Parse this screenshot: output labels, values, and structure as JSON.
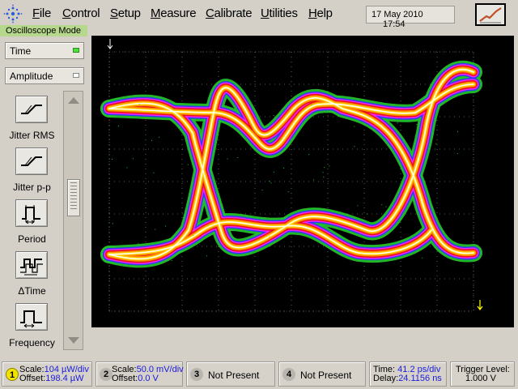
{
  "menu": {
    "file_u": "F",
    "file_rest": "ile",
    "control_u": "C",
    "control_rest": "ontrol",
    "setup_u": "S",
    "setup_rest": "etup",
    "measure_u": "M",
    "measure_rest": "easure",
    "calibrate_u": "C",
    "calibrate_rest": "alibrate",
    "utilities_u": "U",
    "utilities_rest": "tilities",
    "help_u": "H",
    "help_rest": "elp"
  },
  "datetime": {
    "date": "17 May 2010",
    "time": "17:54"
  },
  "mode_tab": "Oscilloscope Mode",
  "left_panel": {
    "time_dropdown": "Time",
    "amplitude_dropdown": "Amplitude",
    "measurements": [
      {
        "label": "Jitter RMS",
        "icon": "jitter-rms-icon"
      },
      {
        "label": "Jitter p-p",
        "icon": "jitter-pp-icon"
      },
      {
        "label": "Period",
        "icon": "period-icon"
      },
      {
        "label": "ΔTime",
        "icon": "delta-time-icon"
      },
      {
        "label": "Frequency",
        "icon": "frequency-icon"
      }
    ]
  },
  "colors": {
    "screen_bg": "#000000",
    "grid": "#7a7a7a",
    "eye_outer": "#22c22a",
    "eye_blue": "#3232ff",
    "eye_magenta": "#ff20ff",
    "eye_red": "#e61010",
    "eye_orange": "#ff8a00",
    "eye_yellow": "#ffd800",
    "eye_core": "#ffffff",
    "marker": "#ffff00",
    "active_channel": "#f2e400"
  },
  "channels": [
    {
      "number": "1",
      "scale_label": "Scale:",
      "scale_value": "104 µW/div",
      "offset_label": "Offset:",
      "offset_value": "198.4 µW",
      "active": true
    },
    {
      "number": "2",
      "scale_label": "Scale:",
      "scale_value": "50.0 mV/div",
      "offset_label": "Offset:",
      "offset_value": "0.0 V",
      "active": false
    },
    {
      "number": "3",
      "status": "Not Present"
    },
    {
      "number": "4",
      "status": "Not Present"
    }
  ],
  "timebase": {
    "time_label": "Time:",
    "time_value": "41.2 ps/div",
    "delay_label": "Delay:",
    "delay_value": "24.1156 ns"
  },
  "trigger": {
    "label": "Trigger Level:",
    "value": "1.000 V"
  }
}
